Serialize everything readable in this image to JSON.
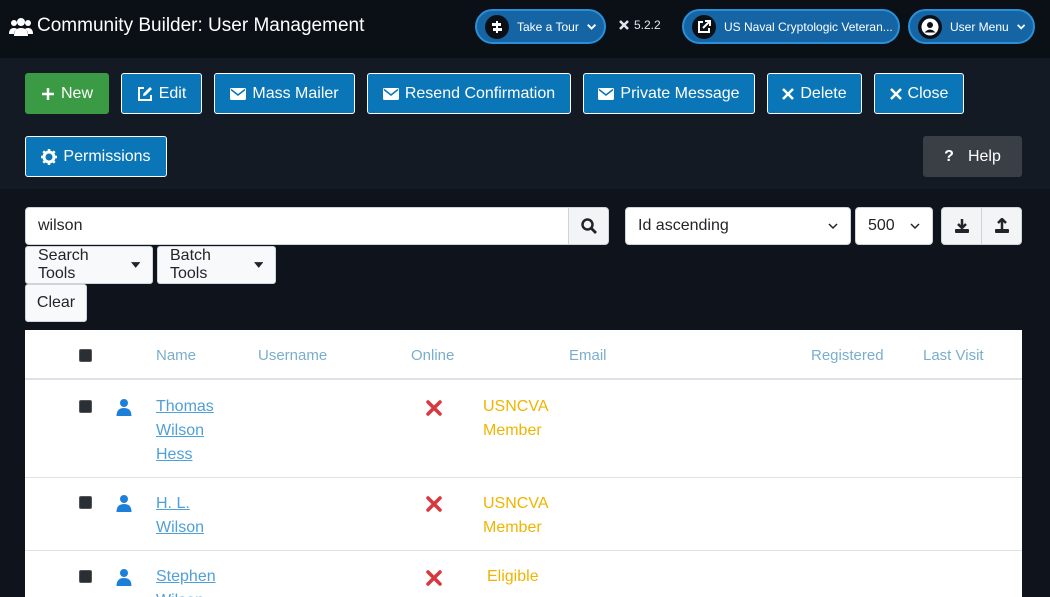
{
  "header": {
    "title": "Community Builder: User Management",
    "tour_label": "Take a Tour",
    "version": "5.2.2",
    "site_label": "US Naval Cryptologic Veteran...",
    "user_menu_label": "User Menu"
  },
  "toolbar": {
    "new_label": "New",
    "edit_label": "Edit",
    "mass_mailer_label": "Mass Mailer",
    "resend_label": "Resend Confirmation",
    "private_message_label": "Private Message",
    "delete_label": "Delete",
    "close_label": "Close",
    "permissions_label": "Permissions",
    "help_label": "Help"
  },
  "filters": {
    "search_value": "wilson",
    "sort_selected": "Id ascending",
    "limit_selected": "500",
    "search_tools_label": "Search Tools",
    "batch_tools_label": "Batch Tools",
    "clear_label": "Clear"
  },
  "table": {
    "columns": [
      "Name",
      "Username",
      "Online",
      "Email",
      "Registered",
      "Last Visit"
    ],
    "rows": [
      {
        "name_lines": [
          "Thomas",
          "Wilson",
          "Hess"
        ],
        "status_lines": [
          "USNCVA",
          "Member"
        ]
      },
      {
        "name_lines": [
          "H. L.",
          "Wilson"
        ],
        "status_lines": [
          "USNCVA",
          "Member"
        ]
      },
      {
        "name_lines": [
          "Stephen",
          "Wilson"
        ],
        "status_lines": [
          "Eligible"
        ]
      }
    ]
  },
  "colors": {
    "accent": "#0b76b7",
    "success": "#3b9a44",
    "danger": "#d9363e",
    "warning": "#f0b400"
  }
}
